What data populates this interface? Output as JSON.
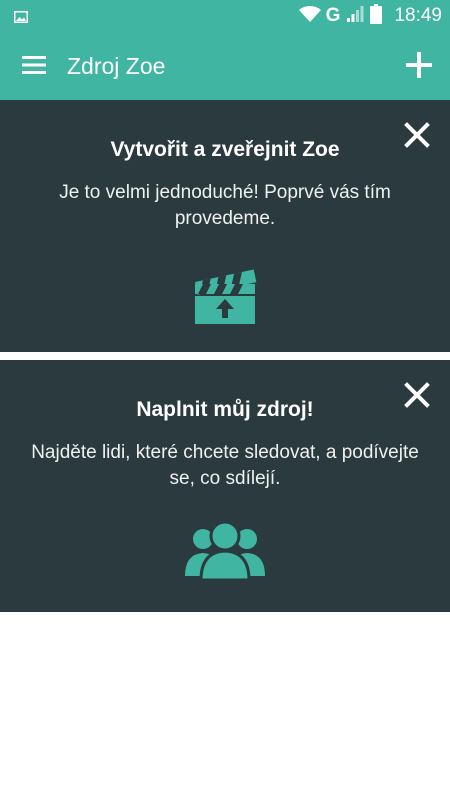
{
  "status_bar": {
    "network_type": "G",
    "time": "18:49",
    "icons": [
      "image-thumbnail-icon",
      "wifi-icon",
      "signal-icon",
      "battery-icon"
    ]
  },
  "app_bar": {
    "title": "Zdroj Zoe",
    "menu_icon": "hamburger-menu-icon",
    "add_icon": "plus-icon"
  },
  "cards": [
    {
      "title": "Vytvořit a zveřejnit Zoe",
      "body": "Je to velmi jednoduché! Poprvé vás tím provedeme.",
      "icon": "clapperboard-upload-icon",
      "close_icon": "close-icon"
    },
    {
      "title": "Naplnit můj zdroj!",
      "body": "Najděte lidi, které chcete sledovat, a podívejte se, co sdílejí.",
      "icon": "people-group-icon",
      "close_icon": "close-icon"
    }
  ],
  "colors": {
    "accent": "#3fb5a2",
    "card_background": "#2b3a3e",
    "page_background": "#ffffff",
    "text": "#ffffff"
  }
}
